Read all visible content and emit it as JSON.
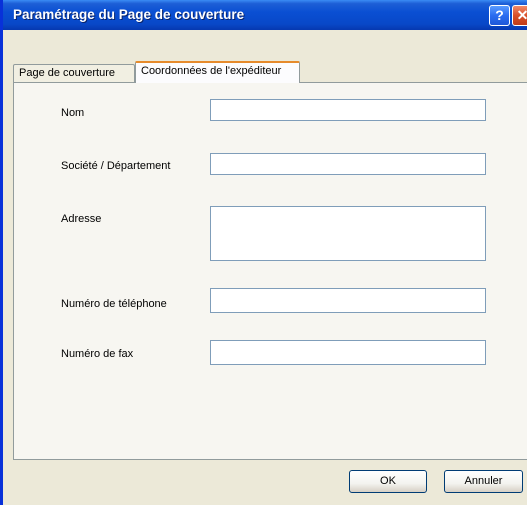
{
  "window": {
    "title": "Paramétrage du Page de couverture",
    "help_label": "?",
    "close_label": "✕"
  },
  "tabs": [
    {
      "label": "Page de couverture",
      "active": false
    },
    {
      "label": "Coordonnées de l'expéditeur",
      "active": true
    }
  ],
  "form": {
    "name_label": "Nom",
    "name_value": "",
    "company_label": "Société / Département",
    "company_value": "",
    "address_label": "Adresse",
    "address_value": "",
    "phone_label": "Numéro de téléphone",
    "phone_value": "",
    "fax_label": "Numéro de fax",
    "fax_value": ""
  },
  "buttons": {
    "ok_label": "OK",
    "cancel_label": "Annuler"
  }
}
